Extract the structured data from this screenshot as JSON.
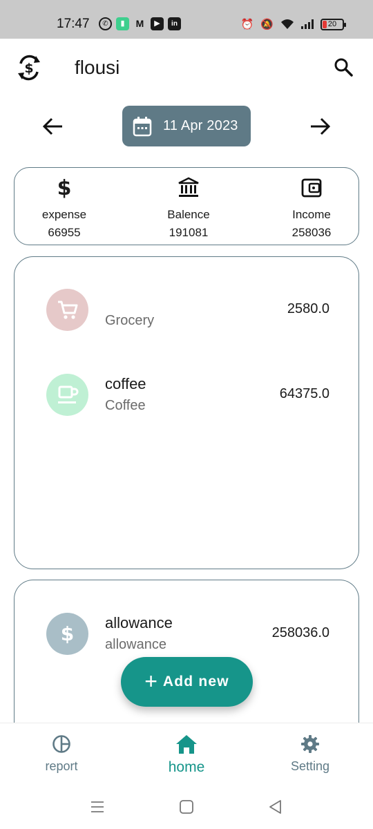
{
  "status_bar": {
    "time": "17:47",
    "battery": "20",
    "left_icons": [
      "whatsapp-icon",
      "battery-saver-icon",
      "gmail-icon",
      "youtube-icon",
      "linkedin-icon"
    ],
    "right_icons": [
      "alarm-icon",
      "mute-icon",
      "wifi-icon",
      "signal-icon",
      "battery-icon"
    ]
  },
  "app": {
    "title": "flousi",
    "accent": "#16958a",
    "primary": "#5f7a86"
  },
  "date_nav": {
    "date": "11 Apr 2023"
  },
  "summary": {
    "expense_label": "expense",
    "expense_value": "66955",
    "balance_label": "Balence",
    "balance_value": "191081",
    "income_label": "Income",
    "income_value": "258036"
  },
  "expenses": [
    {
      "title": "",
      "category": "Grocery",
      "amount": "2580.0",
      "icon": "cart-icon",
      "color": "#e6c9c9"
    },
    {
      "title": "coffee",
      "category": "Coffee",
      "amount": "64375.0",
      "icon": "coffee-icon",
      "color": "#bff0d4"
    }
  ],
  "incomes": [
    {
      "title": "allowance",
      "category": "allowance",
      "amount": "258036.0",
      "icon": "dollar-icon",
      "color": "#a9bec7"
    }
  ],
  "fab": {
    "label": "Add new"
  },
  "bottom_nav": {
    "report": "report",
    "home": "home",
    "setting": "Setting"
  }
}
